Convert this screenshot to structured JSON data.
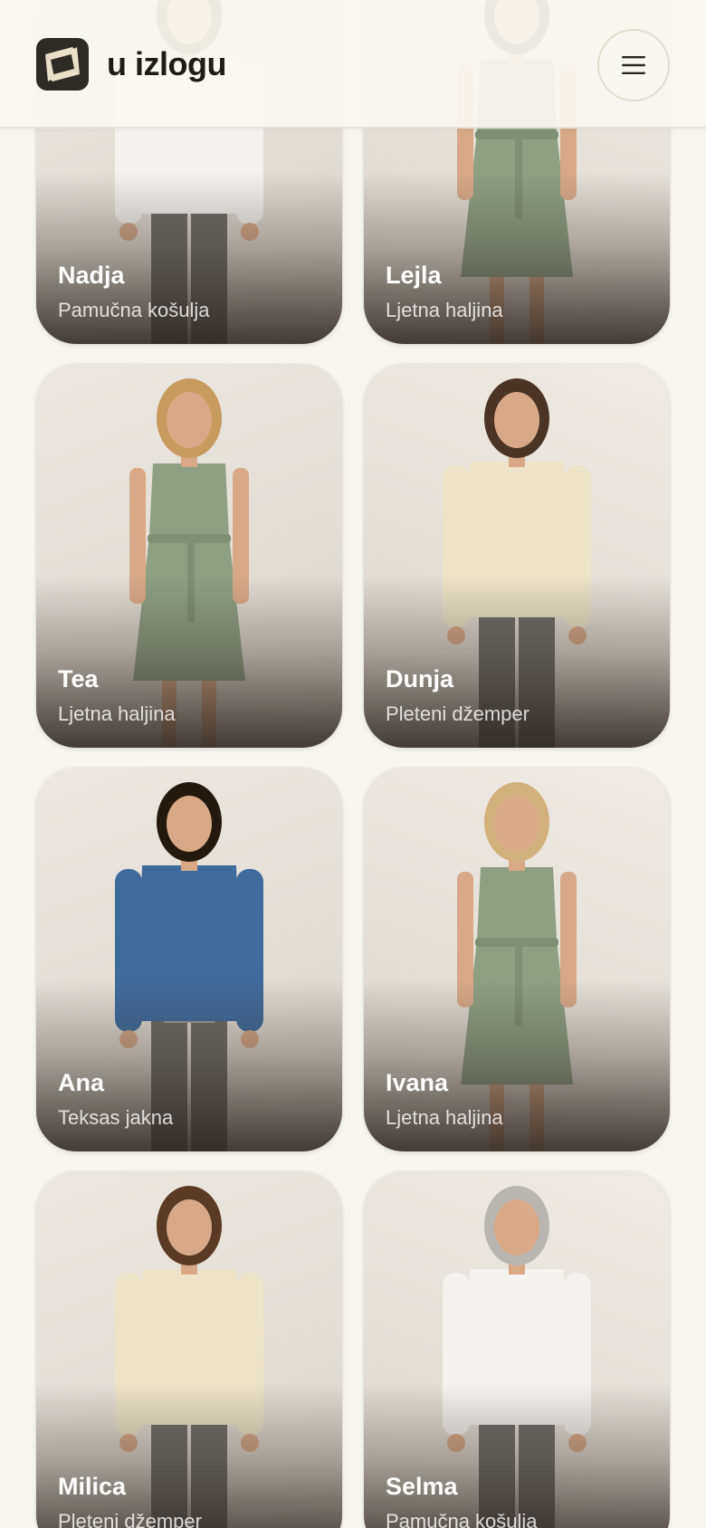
{
  "header": {
    "brand": "u izlogu",
    "logo_icon": "frame-logo-icon",
    "menu_icon": "hamburger-menu-icon"
  },
  "colors": {
    "background": "#f8f6f0",
    "logo_dark": "#2e2a25",
    "logo_cream": "#eadfc8",
    "sage_dress": "#8e9f84",
    "cream_sweater": "#ece3c9",
    "denim": "#3f6a9c",
    "white_shirt": "#f4f3f0",
    "gray_pants": "#6c6a67"
  },
  "cards": [
    {
      "name": "Nadja",
      "product": "Pamučna košulja",
      "outfit": "white-shirt",
      "hair": "#5b3b26"
    },
    {
      "name": "Lejla",
      "product": "Ljetna haljina",
      "outfit": "sage-dress",
      "hair": "#3a2a20"
    },
    {
      "name": "Tea",
      "product": "Ljetna haljina",
      "outfit": "sage-dress",
      "hair": "#c79a5e"
    },
    {
      "name": "Dunja",
      "product": "Pleteni džemper",
      "outfit": "cream-sweater",
      "hair": "#4a3426"
    },
    {
      "name": "Ana",
      "product": "Teksas jakna",
      "outfit": "denim-jacket",
      "hair": "#24190f"
    },
    {
      "name": "Ivana",
      "product": "Ljetna haljina",
      "outfit": "sage-dress",
      "hair": "#d2b07c"
    },
    {
      "name": "Milica",
      "product": "Pleteni džemper",
      "outfit": "cream-sweater",
      "hair": "#5a3a24"
    },
    {
      "name": "Selma",
      "product": "Pamučna košulja",
      "outfit": "white-shirt",
      "hair": "#b9b6b2"
    }
  ]
}
